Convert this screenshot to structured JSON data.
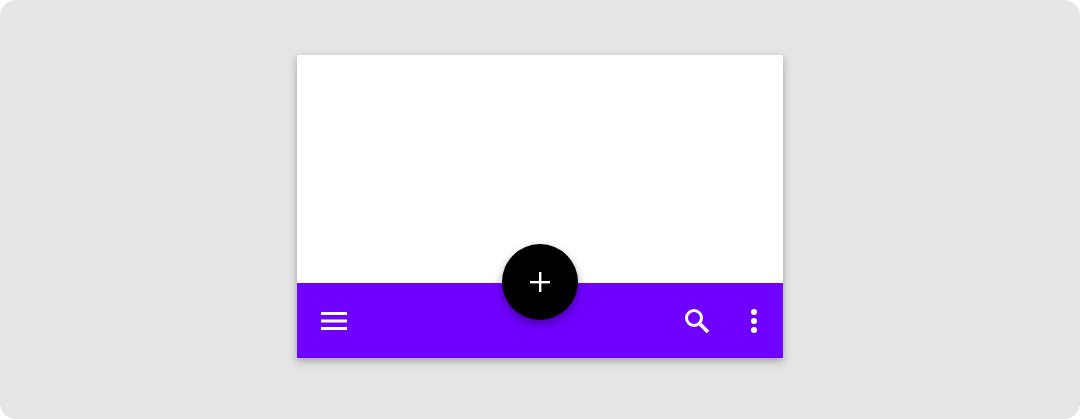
{
  "bottom_app_bar": {
    "navigation": {
      "kind": "menu"
    },
    "fab": {
      "kind": "add"
    },
    "actions": [
      {
        "kind": "search"
      },
      {
        "kind": "more"
      }
    ]
  }
}
